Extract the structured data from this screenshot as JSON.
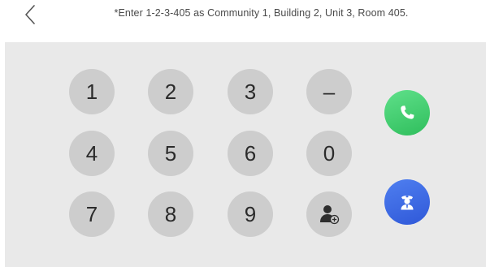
{
  "header": {
    "back_icon": "chevron-left-icon",
    "hint": "*Enter 1-2-3-405 as Community 1, Building 2, Unit 3, Room 405."
  },
  "keypad": {
    "keys": [
      "1",
      "2",
      "3",
      "–",
      "4",
      "5",
      "6",
      "0",
      "7",
      "8",
      "9"
    ],
    "contact_icon": "add-contact-icon"
  },
  "actions": {
    "call_icon": "phone-icon",
    "call_color": "#3cc96a",
    "guard_icon": "security-guard-icon",
    "guard_color": "#3a68e4"
  }
}
